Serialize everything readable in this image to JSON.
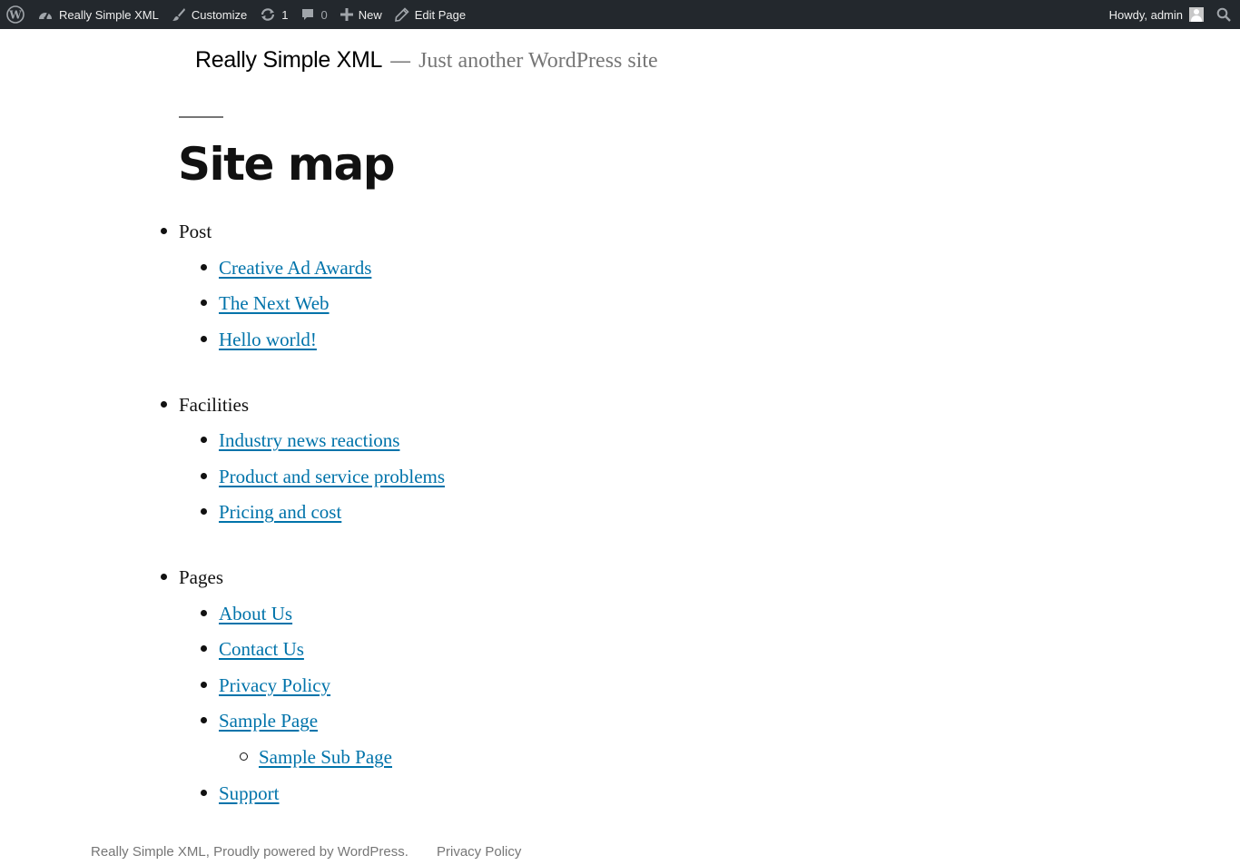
{
  "adminbar": {
    "site_name": "Really Simple XML",
    "customize": "Customize",
    "updates_count": "1",
    "comments_count": "0",
    "new_label": "New",
    "edit_label": "Edit Page",
    "howdy": "Howdy, admin",
    "colors": {
      "bar_bg": "#23282d",
      "text": "#eeeeee",
      "muted": "#a0a5aa"
    }
  },
  "header": {
    "site_title": "Really Simple XML",
    "separator": "—",
    "tagline": "Just another WordPress site"
  },
  "page": {
    "title": "Site map"
  },
  "sitemap": {
    "sections": [
      {
        "label": "Post",
        "items": [
          {
            "label": "Creative Ad Awards"
          },
          {
            "label": "The Next Web"
          },
          {
            "label": "Hello world!"
          }
        ]
      },
      {
        "label": "Facilities",
        "items": [
          {
            "label": "Industry news reactions"
          },
          {
            "label": "Product and service problems"
          },
          {
            "label": "Pricing and cost"
          }
        ]
      },
      {
        "label": "Pages",
        "items": [
          {
            "label": "About Us"
          },
          {
            "label": "Contact Us"
          },
          {
            "label": "Privacy Policy"
          },
          {
            "label": "Sample Page"
          },
          {
            "label": "Sample Sub Page"
          },
          {
            "label": "Support"
          }
        ]
      }
    ],
    "link_color": "#0073aa"
  },
  "footer": {
    "site": "Really Simple XML,",
    "powered": "Proudly powered by WordPress.",
    "privacy": "Privacy Policy"
  }
}
